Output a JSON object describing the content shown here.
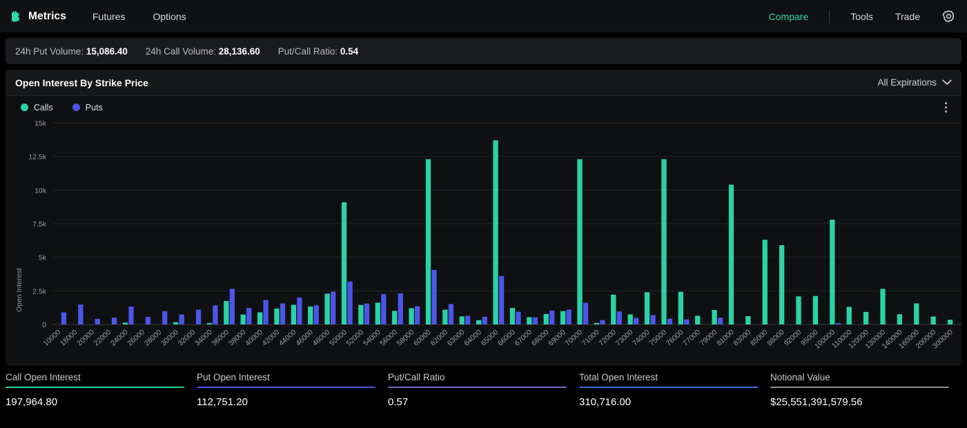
{
  "nav": {
    "brand": "Metrics",
    "brand_icon": "bitcoin-logo-icon",
    "left_links": [
      {
        "label": "Futures",
        "name": "nav-link-futures"
      },
      {
        "label": "Options",
        "name": "nav-link-options"
      }
    ],
    "right_links": [
      {
        "label": "Compare",
        "name": "nav-link-compare",
        "active": true
      },
      {
        "label": "Tools",
        "name": "nav-link-tools",
        "active": false
      },
      {
        "label": "Trade",
        "name": "nav-link-trade",
        "active": false
      }
    ],
    "settings_icon": "gear-icon",
    "accent": "#2fd6ab"
  },
  "volume_strip": [
    {
      "label": "24h Put Volume:",
      "value": "15,086.40"
    },
    {
      "label": "24h Call Volume:",
      "value": "28,136.60"
    },
    {
      "label": "Put/Call Ratio:",
      "value": "0.54"
    }
  ],
  "card": {
    "title": "Open Interest By Strike Price",
    "expiration_filter": "All Expirations",
    "chevron_icon": "chevron-down-icon",
    "menu_icon": "kebab-menu-icon"
  },
  "chart_data": {
    "type": "bar",
    "title": "Open Interest By Strike Price",
    "xlabel": "",
    "ylabel": "Open Interest",
    "ylim": [
      0,
      15000
    ],
    "yticks": [
      "0",
      "2.5k",
      "5k",
      "7.5k",
      "10k",
      "12.5k",
      "15k"
    ],
    "ytick_values": [
      0,
      2500,
      5000,
      7500,
      10000,
      12500,
      15000
    ],
    "grid": true,
    "legend_position": "top-left",
    "colors": {
      "calls": "#2ad3a5",
      "puts": "#4d55e8"
    },
    "categories": [
      "10000",
      "18000",
      "20000",
      "22000",
      "24000",
      "26000",
      "28000",
      "30000",
      "32000",
      "34000",
      "36000",
      "38000",
      "40000",
      "42000",
      "44000",
      "46000",
      "48000",
      "50000",
      "52000",
      "54000",
      "56000",
      "58000",
      "60000",
      "62000",
      "63000",
      "64000",
      "65000",
      "66000",
      "67000",
      "68000",
      "69000",
      "70000",
      "71000",
      "72000",
      "73000",
      "74000",
      "75000",
      "76000",
      "77000",
      "79000",
      "81000",
      "83000",
      "85000",
      "88000",
      "92000",
      "95000",
      "100000",
      "110000",
      "120000",
      "130000",
      "140000",
      "160000",
      "200000",
      "300000"
    ],
    "series": [
      {
        "name": "Calls",
        "values": [
          0,
          0,
          0,
          0,
          140,
          0,
          0,
          170,
          0,
          110,
          1750,
          740,
          900,
          1190,
          1460,
          1330,
          2290,
          9100,
          1450,
          1620,
          1010,
          1210,
          12300,
          1100,
          600,
          320,
          13700,
          1230,
          540,
          780,
          1000,
          12300,
          110,
          2220,
          750,
          2400,
          12300,
          2430,
          650,
          1080,
          10400,
          620,
          6300,
          5900,
          2090,
          2120,
          7800,
          1310,
          930,
          2650,
          760,
          1570,
          590,
          350
        ]
      },
      {
        "name": "Puts",
        "values": [
          900,
          1480,
          420,
          500,
          1330,
          560,
          990,
          740,
          1100,
          1420,
          2650,
          1230,
          1820,
          1560,
          2000,
          1420,
          2440,
          3200,
          1560,
          2250,
          2310,
          1360,
          4060,
          1520,
          640,
          570,
          3610,
          950,
          530,
          1030,
          1100,
          1620,
          330,
          970,
          490,
          700,
          430,
          380,
          0,
          500,
          0,
          0,
          0,
          0,
          0,
          0,
          90,
          0,
          0,
          0,
          0,
          0,
          0,
          0
        ]
      }
    ]
  },
  "stats": [
    {
      "label": "Call Open Interest",
      "value": "197,964.80",
      "rule_color": "#2ad3a5"
    },
    {
      "label": "Put Open Interest",
      "value": "112,751.20",
      "rule_color": "#4d55e8"
    },
    {
      "label": "Put/Call Ratio",
      "value": "0.57",
      "rule_color": "#7a63c4"
    },
    {
      "label": "Total Open Interest",
      "value": "310,716.00",
      "rule_color": "#3b6fd4"
    },
    {
      "label": "Notional Value",
      "value": "$25,551,391,579.56",
      "rule_color": "#8b8d94"
    }
  ]
}
